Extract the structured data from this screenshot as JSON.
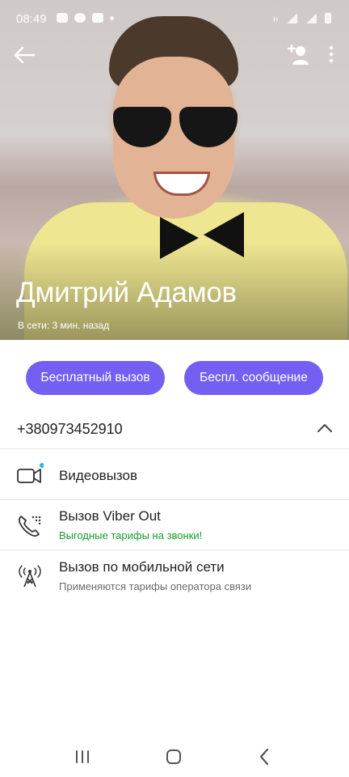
{
  "status_bar": {
    "time": "08:49",
    "network_label": "H"
  },
  "profile": {
    "name": "Дмитрий Адамов",
    "last_seen": "В сети: 3 мин. назад"
  },
  "actions": {
    "free_call_label": "Бесплатный вызов",
    "free_message_label": "Беспл. сообщение"
  },
  "phone": {
    "number": "+380973452910"
  },
  "call_options": [
    {
      "title": "Видеовызов",
      "subtitle": "",
      "icon": "video-camera-icon"
    },
    {
      "title": "Вызов Viber Out",
      "subtitle": "Выгодные тарифы на звонки!",
      "icon": "viber-out-phone-icon"
    },
    {
      "title": "Вызов по мобильной сети",
      "subtitle": "Применяются тарифы оператора связи",
      "icon": "cell-tower-icon"
    }
  ],
  "colors": {
    "accent": "#7360f2",
    "promo_green": "#1a9b2e",
    "notification_dot": "#29b6f6"
  }
}
